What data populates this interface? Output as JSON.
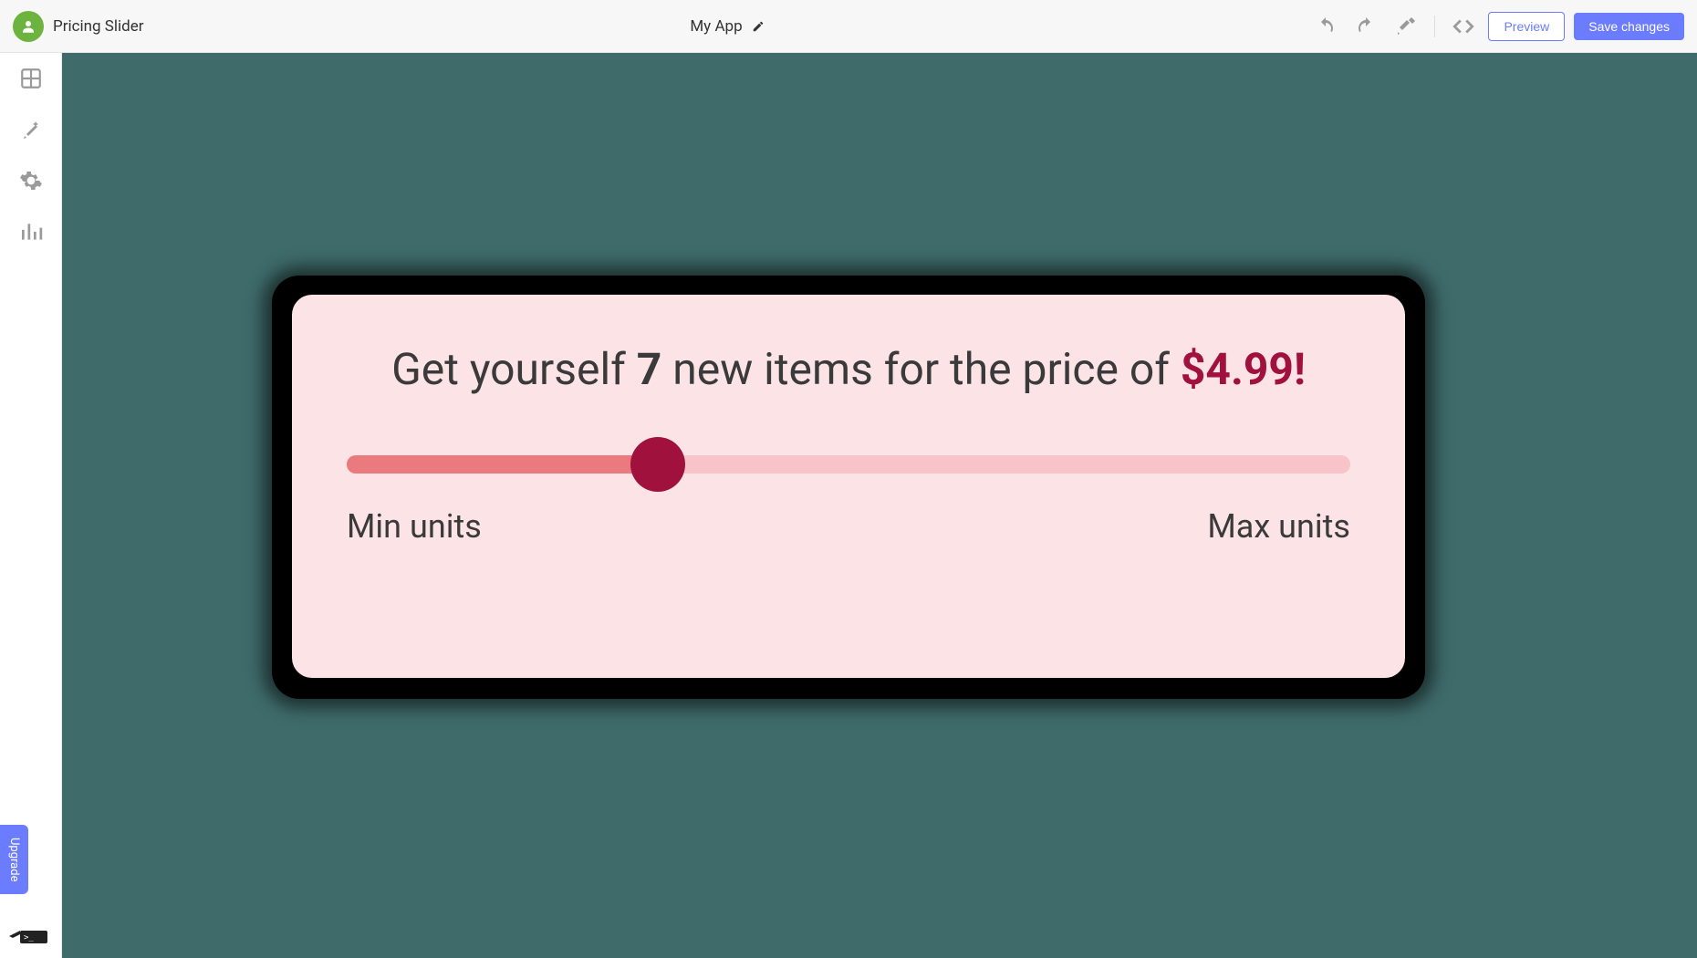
{
  "header": {
    "project_name": "Pricing Slider",
    "app_title": "My App",
    "preview_label": "Preview",
    "save_label": "Save changes"
  },
  "sidebar": {
    "upgrade_label": "Upgrade"
  },
  "card": {
    "headline_prefix": "Get yourself ",
    "item_count": "7",
    "headline_mid": " new items for the price of ",
    "price": "$4.99!",
    "min_label": "Min units",
    "max_label": "Max units",
    "slider_percent": 31
  }
}
